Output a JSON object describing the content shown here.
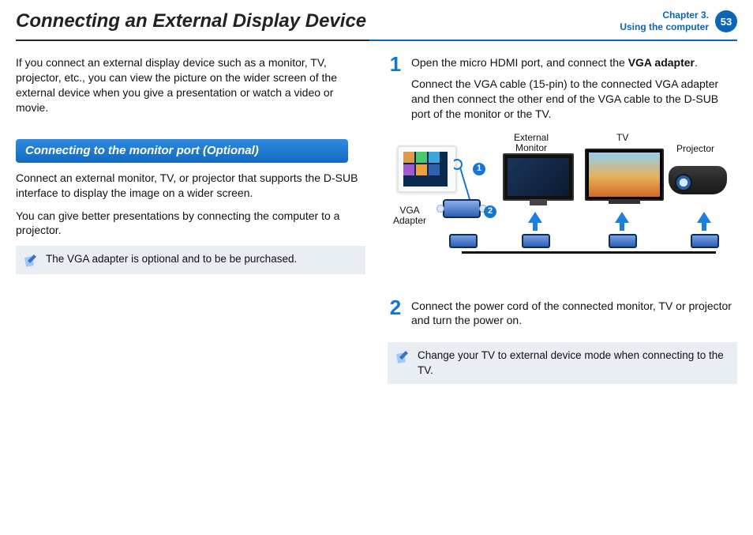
{
  "header": {
    "title": "Connecting an External Display Device",
    "chapter_line1": "Chapter 3.",
    "chapter_line2": "Using the computer",
    "page_number": "53"
  },
  "left": {
    "intro": "If you connect an external display device such as a monitor, TV, projector, etc., you can view the picture on the wider screen of the external device when you give a presentation or watch a video or movie.",
    "section_title": "Connecting to the monitor port (Optional)",
    "body1": "Connect an external monitor, TV, or projector that supports the D-SUB interface to display the image on a wider screen.",
    "body2": "You can give better presentations by connecting the computer to a projector.",
    "note": "The VGA adapter is optional and to be be purchased."
  },
  "right": {
    "step1_num": "1",
    "step1_line1_pre": "Open the micro HDMI port, and connect the ",
    "step1_line1_bold": "VGA adapter",
    "step1_line1_post": ".",
    "step1_line2": "Connect the VGA cable (15-pin) to the connected VGA adapter and then connect the other end of the VGA cable to the D-SUB port of the monitor or the TV.",
    "step2_num": "2",
    "step2": "Connect the power cord of the connected monitor, TV or projector and turn the power on.",
    "note": "Change your TV to external device mode when connecting to the TV.",
    "illus": {
      "vga_adapter": "VGA\nAdapter",
      "external_monitor": "External\nMonitor",
      "tv": "TV",
      "projector": "Projector",
      "badge1": "1",
      "badge2": "2"
    }
  }
}
